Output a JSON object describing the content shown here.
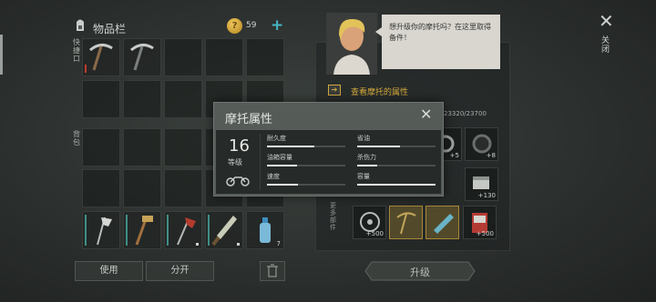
{
  "inventory": {
    "title": "物品栏",
    "coin_symbol": "?",
    "coin_count": "59",
    "add_label": "+",
    "label_quick": "快捷口",
    "label_pack": "背包",
    "use_button": "使用",
    "split_button": "分开",
    "trash_icon": "trash-icon",
    "slots": [
      {
        "name": "pickaxe-slot",
        "icon": "pickaxe-icon",
        "durability": 0.25
      },
      {
        "name": "pickaxe-slot-2",
        "icon": "pickaxe-icon"
      },
      {
        "name": "axe-slot",
        "icon": "axe-icon",
        "qty": "",
        "durability": 1.0
      },
      {
        "name": "hammer-slot",
        "icon": "hammer-icon",
        "durability": 1.0
      },
      {
        "name": "axe-bloody-slot",
        "icon": "bloody-axe-icon",
        "durability": 1.0
      },
      {
        "name": "machete-slot",
        "icon": "machete-icon",
        "durability": 1.0
      },
      {
        "name": "water-bottle-slot",
        "icon": "water-bottle-icon",
        "qty": "7"
      }
    ]
  },
  "garage": {
    "npc_dialog": "想升级你的摩托吗？在这里取得备件！",
    "view_properties": "查看摩托的属性",
    "moto_stat_text": "23320/23700",
    "upgrade_button": "升级",
    "parts": [
      {
        "name": "part-rope",
        "qty": "+5"
      },
      {
        "name": "part-tire-small",
        "qty": "+8"
      },
      {
        "name": "part-crate",
        "qty": "+130"
      },
      {
        "name": "part-wheel",
        "qty": "+500"
      },
      {
        "name": "part-yellow-tool",
        "qty": ""
      },
      {
        "name": "part-cylinder",
        "qty": ""
      },
      {
        "name": "part-manual",
        "qty": "+500"
      }
    ],
    "side_text": "更多部件"
  },
  "close": {
    "icon": "close-icon",
    "label": "关闭"
  },
  "popup": {
    "title": "摩托属性",
    "level": "16",
    "level_label": "等级",
    "stats": [
      {
        "label": "耐久度",
        "value": 0.6
      },
      {
        "label": "省油",
        "value": 0.55
      },
      {
        "label": "油箱容量",
        "value": 0.38
      },
      {
        "label": "杀伤力",
        "value": 0.25
      },
      {
        "label": "速度",
        "value": 0.4
      },
      {
        "label": "容量",
        "value": 1.0
      }
    ]
  },
  "colors": {
    "accent": "#d6ab3c",
    "teal": "#46b4c3",
    "panel": "#555b57"
  }
}
